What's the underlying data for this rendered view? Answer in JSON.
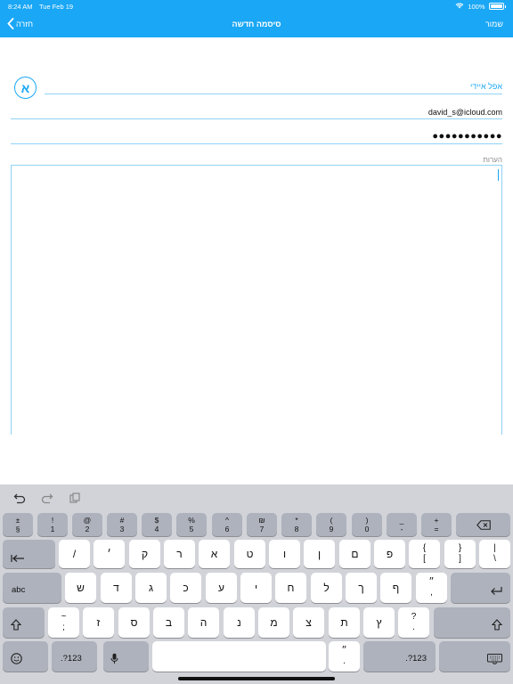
{
  "status_bar": {
    "time": "8:24 AM",
    "date": "Tue Feb 19",
    "battery": "100%"
  },
  "nav": {
    "title": "סיסמה חדשה",
    "save": "שמור",
    "back": "חזרה"
  },
  "form": {
    "avatar_letter": "א",
    "title_value": "אפל איידי",
    "username_value": "david_s@icloud.com",
    "password_value": "●●●●●●●●●●●",
    "notes_label": "הערות"
  },
  "keyboard": {
    "row1": [
      {
        "top": "±",
        "bottom": "§"
      },
      {
        "top": "!",
        "bottom": "1"
      },
      {
        "top": "@",
        "bottom": "2"
      },
      {
        "top": "#",
        "bottom": "3"
      },
      {
        "top": "$",
        "bottom": "4"
      },
      {
        "top": "%",
        "bottom": "5"
      },
      {
        "top": "^",
        "bottom": "6"
      },
      {
        "top": "₪",
        "bottom": "7"
      },
      {
        "top": "*",
        "bottom": "8"
      },
      {
        "top": "(",
        "bottom": "9"
      },
      {
        "top": ")",
        "bottom": "0"
      },
      {
        "top": "_",
        "bottom": "-"
      },
      {
        "top": "+",
        "bottom": "="
      }
    ],
    "row2": [
      "/",
      "׳",
      "ק",
      "ר",
      "א",
      "ט",
      "ו",
      "ן",
      "ם",
      "פ"
    ],
    "row2_extra": [
      {
        "top": "{",
        "bottom": "["
      },
      {
        "top": "}",
        "bottom": "]"
      },
      {
        "top": "|",
        "bottom": "\\"
      }
    ],
    "row3": [
      "ש",
      "ד",
      "ג",
      "כ",
      "ע",
      "י",
      "ח",
      "ל",
      "ך",
      "ף"
    ],
    "row3_extra": {
      "top": "״",
      "bottom": ","
    },
    "row4_first": {
      "top": "~",
      "bottom": ";"
    },
    "row4": [
      "ז",
      "ס",
      "ב",
      "ה",
      "נ",
      "מ",
      "צ",
      "ת",
      "ץ"
    ],
    "row4_extra": {
      "top": "?",
      "bottom": "."
    },
    "abc": "abc",
    "numbers_left": ".?123",
    "numbers_right": ".?123",
    "period_key": {
      "top": "״",
      "bottom": "."
    }
  }
}
